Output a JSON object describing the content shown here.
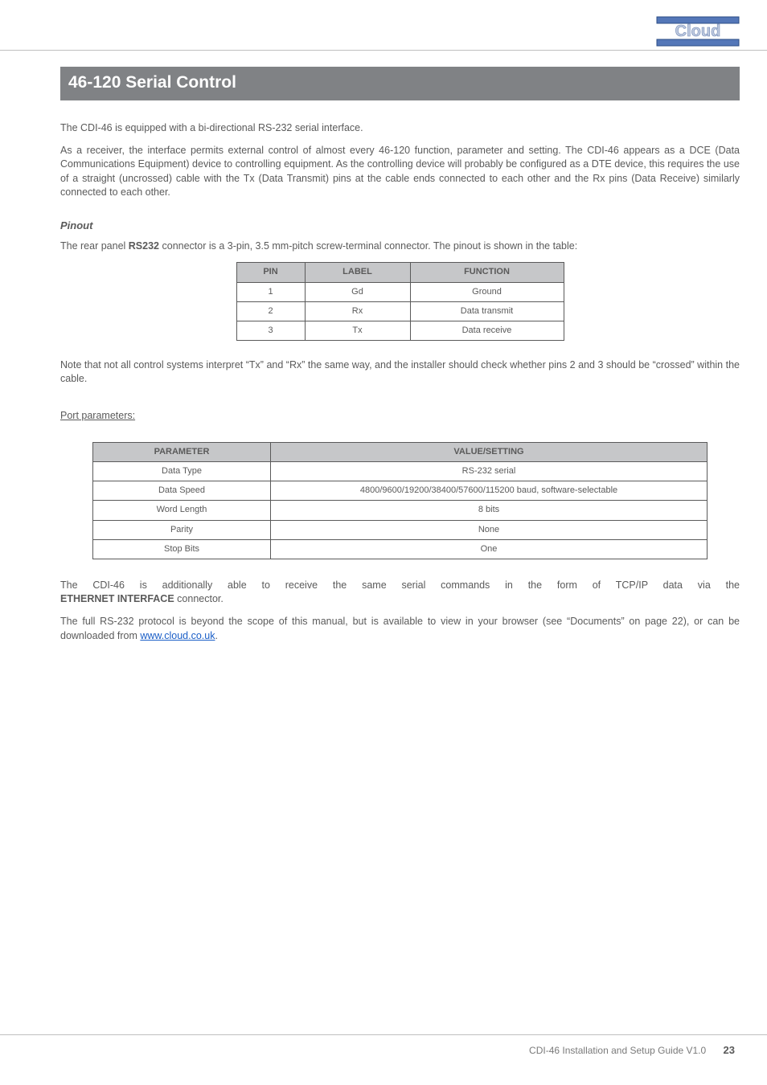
{
  "logo_text": "Cloud",
  "title_bar": "46-120 Serial Control",
  "intro_p1": "The CDI-46 is equipped with a bi-directional RS-232 serial interface.",
  "intro_p2": "As a receiver, the interface permits external control of almost every 46-120 function, parameter and setting. The CDI-46 appears as a DCE (Data Communications Equipment) device to controlling equipment. As the controlling device will probably be configured as a DTE device, this requires the use of a straight (uncrossed) cable with the Tx (Data Transmit) pins at the cable ends connected to each other and the Rx pins (Data Receive) similarly connected to each other.",
  "pinout_heading": "Pinout",
  "pinout_intro_a": "The rear panel ",
  "pinout_intro_bold": "RS232",
  "pinout_intro_b": " connector is a 3-pin, 3.5 mm-pitch screw-terminal connector. The pinout is shown in the table:",
  "table1": {
    "headers": {
      "c1": "PIN",
      "c2": "LABEL",
      "c3": "FUNCTION"
    },
    "rows": [
      {
        "c1": "1",
        "c2": "Gd",
        "c3": "Ground"
      },
      {
        "c1": "2",
        "c2": "Rx",
        "c3": "Data transmit"
      },
      {
        "c1": "3",
        "c2": "Tx",
        "c3": "Data receive"
      }
    ]
  },
  "note_p": "Note that not all control systems interpret “Tx” and “Rx” the same way, and the installer should check whether pins 2 and 3 should be “crossed” within the cable.",
  "port_params_heading": "Port parameters:",
  "table2": {
    "headers": {
      "c1": "PARAMETER",
      "c2": "VALUE/SETTING"
    },
    "rows": [
      {
        "c1": "Data Type",
        "c2": "RS-232 serial"
      },
      {
        "c1": "Data Speed",
        "c2": "4800/9600/19200/38400/57600/115200 baud, software-selectable"
      },
      {
        "c1": "Word Length",
        "c2": "8 bits"
      },
      {
        "c1": "Parity",
        "c2": "None"
      },
      {
        "c1": "Stop Bits",
        "c2": "One"
      }
    ]
  },
  "final_p1_a": "The CDI-46 is additionally able to receive the same serial commands in the form of TCP/IP data via the ",
  "final_p1_bold": "ETHERNET INTERFACE",
  "final_p1_b": " connector.",
  "final_p2_a": "The full RS-232 protocol is beyond the scope of this manual, but is available to view in your browser (see “Documents” on page 22), or can be downloaded from ",
  "final_p2_link": "www.cloud.co.uk",
  "final_p2_b": ".",
  "footer_text": "CDI-46 Installation and Setup Guide V1.0",
  "footer_page": "23"
}
